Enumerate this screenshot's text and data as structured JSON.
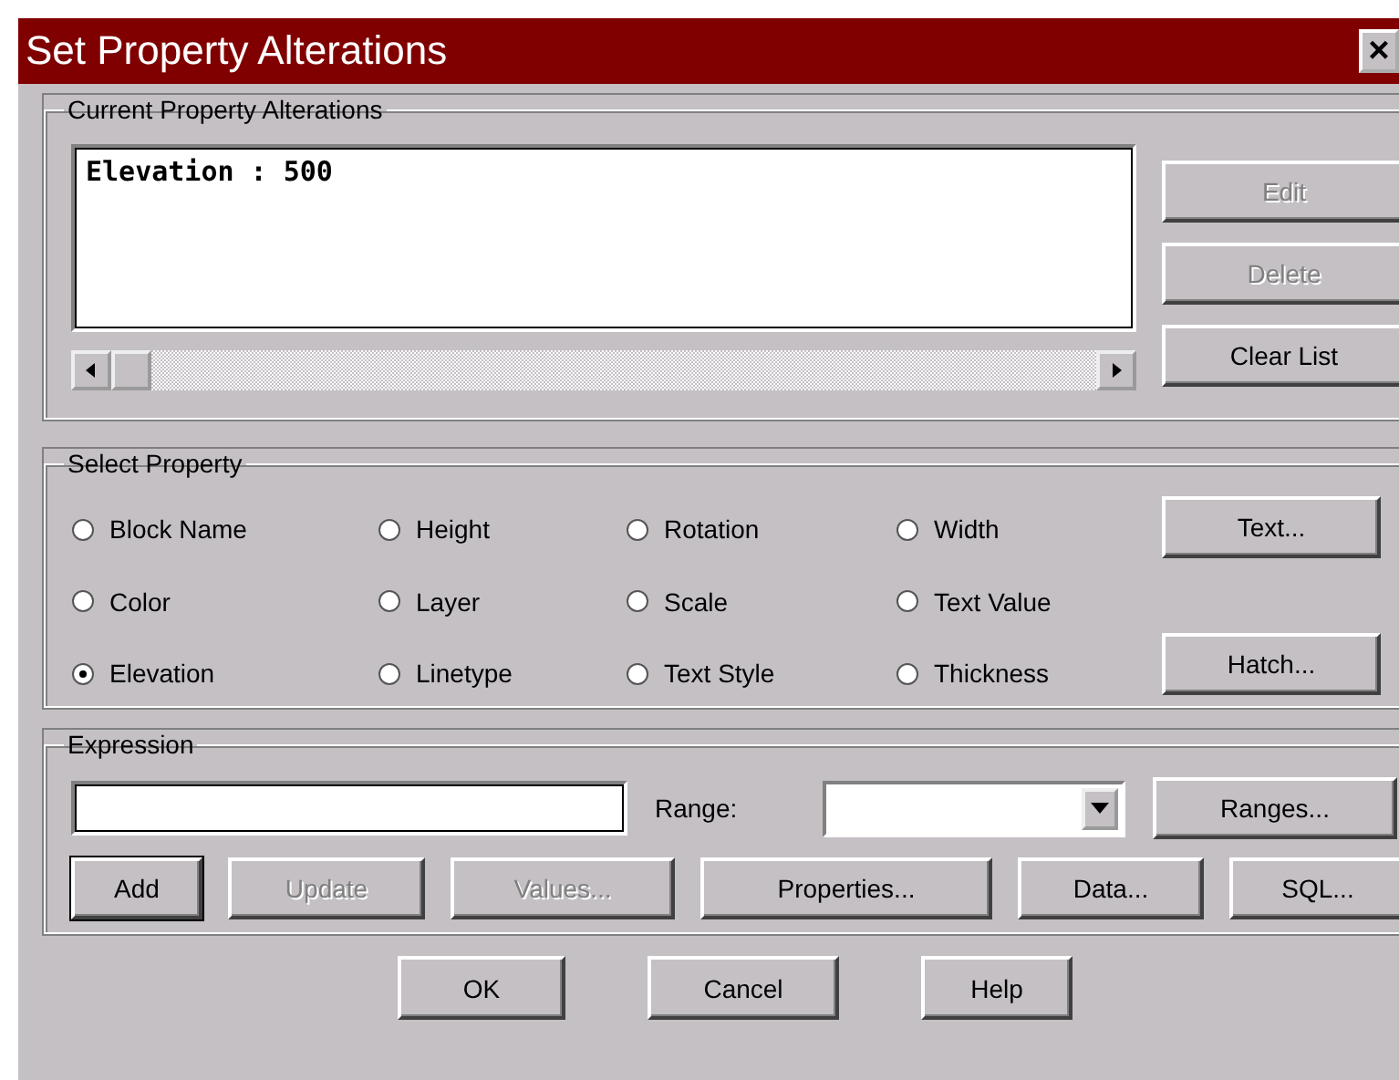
{
  "window": {
    "title": "Set Property Alterations",
    "close": "×"
  },
  "current": {
    "legend": "Current Property Alterations",
    "items": [
      "Elevation : 500"
    ],
    "buttons": [
      {
        "label": "Edit",
        "disabled": true
      },
      {
        "label": "Delete",
        "disabled": true
      },
      {
        "label": "Clear List",
        "disabled": false
      }
    ]
  },
  "select_property": {
    "legend": "Select Property",
    "options": [
      {
        "label": "Block Name",
        "selected": false
      },
      {
        "label": "Height",
        "selected": false
      },
      {
        "label": "Rotation",
        "selected": false
      },
      {
        "label": "Width",
        "selected": false
      },
      {
        "label": "Color",
        "selected": false
      },
      {
        "label": "Layer",
        "selected": false
      },
      {
        "label": "Scale",
        "selected": false
      },
      {
        "label": "Text Value",
        "selected": false
      },
      {
        "label": "Elevation",
        "selected": true
      },
      {
        "label": "Linetype",
        "selected": false
      },
      {
        "label": "Text Style",
        "selected": false
      },
      {
        "label": "Thickness",
        "selected": false
      }
    ],
    "buttons": [
      {
        "label": "Text...",
        "disabled": false
      },
      {
        "label": "Hatch...",
        "disabled": false
      }
    ]
  },
  "expression": {
    "legend": "Expression",
    "range_label": "Range:",
    "ranges_button": "Ranges...",
    "buttons": [
      {
        "label": "Add",
        "disabled": false,
        "default": true
      },
      {
        "label": "Update",
        "disabled": true,
        "default": false
      },
      {
        "label": "Values...",
        "disabled": true,
        "default": false
      },
      {
        "label": "Properties...",
        "disabled": false,
        "default": false
      },
      {
        "label": "Data...",
        "disabled": false,
        "default": false
      },
      {
        "label": "SQL...",
        "disabled": false,
        "default": false
      }
    ]
  },
  "footer_buttons": [
    "OK",
    "Cancel",
    "Help"
  ]
}
